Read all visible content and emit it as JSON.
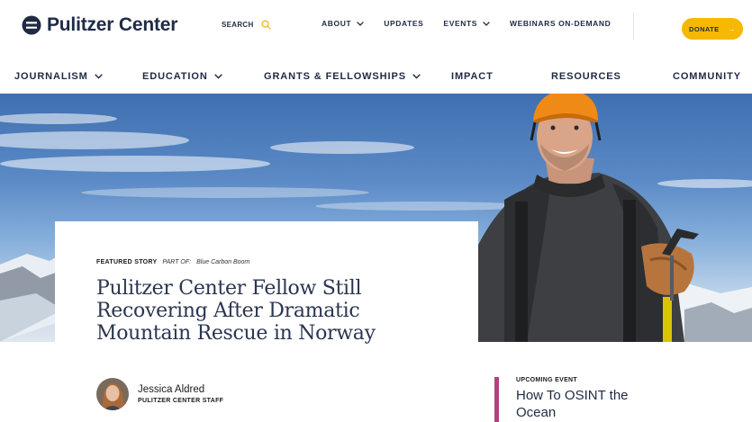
{
  "brand": {
    "name": "Pulitzer Center"
  },
  "search": {
    "label": "SEARCH"
  },
  "topnav": {
    "items": [
      {
        "label": "ABOUT",
        "has_dropdown": true
      },
      {
        "label": "UPDATES",
        "has_dropdown": false
      },
      {
        "label": "EVENTS",
        "has_dropdown": true
      },
      {
        "label": "WEBINARS ON-DEMAND",
        "has_dropdown": false
      }
    ]
  },
  "donate": {
    "label": "DONATE",
    "arrow": "→",
    "color": "#f6b800"
  },
  "mainnav": {
    "items": [
      {
        "label": "JOURNALISM",
        "has_dropdown": true
      },
      {
        "label": "EDUCATION",
        "has_dropdown": true
      },
      {
        "label": "GRANTS & FELLOWSHIPS",
        "has_dropdown": true
      },
      {
        "label": "IMPACT",
        "has_dropdown": false
      },
      {
        "label": "RESOURCES",
        "has_dropdown": false
      },
      {
        "label": "COMMUNITY",
        "has_dropdown": false
      }
    ]
  },
  "story": {
    "kicker": "FEATURED STORY",
    "part_of_label": "PART OF:",
    "part_of_link": "Blue Carbon Boom",
    "headline": "Pulitzer Center Fellow Still Recovering After Dramatic Mountain Rescue in Norway",
    "author": {
      "name": "Jessica Aldred",
      "role": "PULITZER CENTER STAFF"
    }
  },
  "event": {
    "label": "UPCOMING EVENT",
    "title": "How To OSINT the Ocean",
    "accent_color": "#b0437c"
  },
  "icons": {
    "logo": "pulitzer-logo-icon",
    "search": "search-icon",
    "dropdown": "chevron-down-icon",
    "donate_arrow": "arrow-right-icon"
  }
}
